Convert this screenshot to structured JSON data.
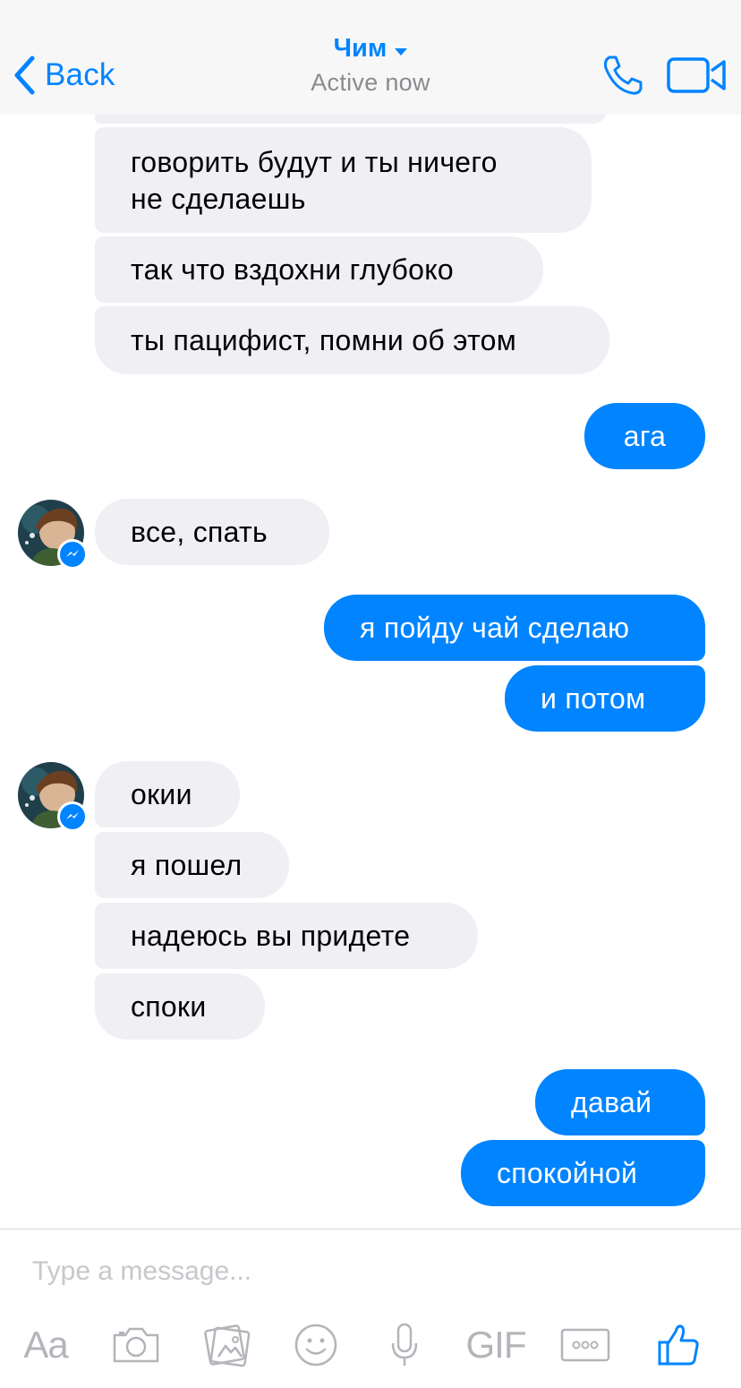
{
  "header": {
    "back_label": "Back",
    "contact_name": "Чим",
    "status": "Active now"
  },
  "colors": {
    "accent": "#0084ff",
    "incoming_bubble": "#f0eff4",
    "header_bg": "#f7f7f8",
    "muted_icon": "#b4b4ba"
  },
  "messages": [
    {
      "side": "in",
      "text": "говорить будут и ты ничего не сделаешь",
      "lines": [
        "говорить будут и ты ничего",
        "не сделаешь"
      ]
    },
    {
      "side": "in",
      "text": "так что вздохни глубоко"
    },
    {
      "side": "in",
      "text": "ты пацифист, помни об этом"
    },
    {
      "side": "out",
      "text": "ага"
    },
    {
      "side": "in",
      "text": "все, спать"
    },
    {
      "side": "out",
      "text": "я пойду чай сделаю"
    },
    {
      "side": "out",
      "text": "и потом"
    },
    {
      "side": "in",
      "text": "окии"
    },
    {
      "side": "in",
      "text": "я пошел"
    },
    {
      "side": "in",
      "text": "надеюсь вы придете"
    },
    {
      "side": "in",
      "text": "споки"
    },
    {
      "side": "out",
      "text": "давай"
    },
    {
      "side": "out",
      "text": "спокойной"
    }
  ],
  "composer": {
    "placeholder": "Type a message...",
    "aa_label": "Aa",
    "gif_label": "GIF"
  },
  "icons": {
    "back": "chevron-left-icon",
    "title_dropdown": "caret-down-icon",
    "call": "phone-icon",
    "video": "video-camera-icon",
    "camera": "camera-icon",
    "gallery": "photo-gallery-icon",
    "emoji": "smiley-icon",
    "mic": "microphone-icon",
    "more": "more-dots-icon",
    "like": "thumbs-up-icon",
    "messenger_badge": "messenger-badge-icon"
  }
}
